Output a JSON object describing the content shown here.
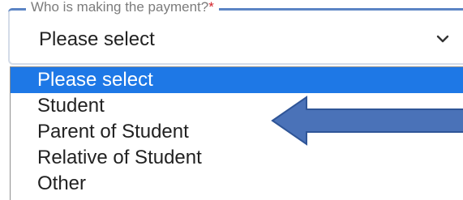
{
  "field": {
    "legend": "Who is making the payment?",
    "required_marker": "*",
    "selected_value": "Please select",
    "chevron_icon": "chevron-down-icon"
  },
  "dropdown": {
    "options": [
      {
        "label": "Please select",
        "highlighted": true
      },
      {
        "label": "Student",
        "highlighted": false
      },
      {
        "label": "Parent of Student",
        "highlighted": false
      },
      {
        "label": "Relative of Student",
        "highlighted": false
      },
      {
        "label": "Other",
        "highlighted": false
      }
    ]
  },
  "annotation": {
    "icon": "left-arrow-icon",
    "fill_color": "#4a72b8",
    "stroke_color": "#2f5597"
  },
  "colors": {
    "highlight": "#1e78e6",
    "accent_border": "#5b84c4",
    "required": "#d2232a"
  }
}
